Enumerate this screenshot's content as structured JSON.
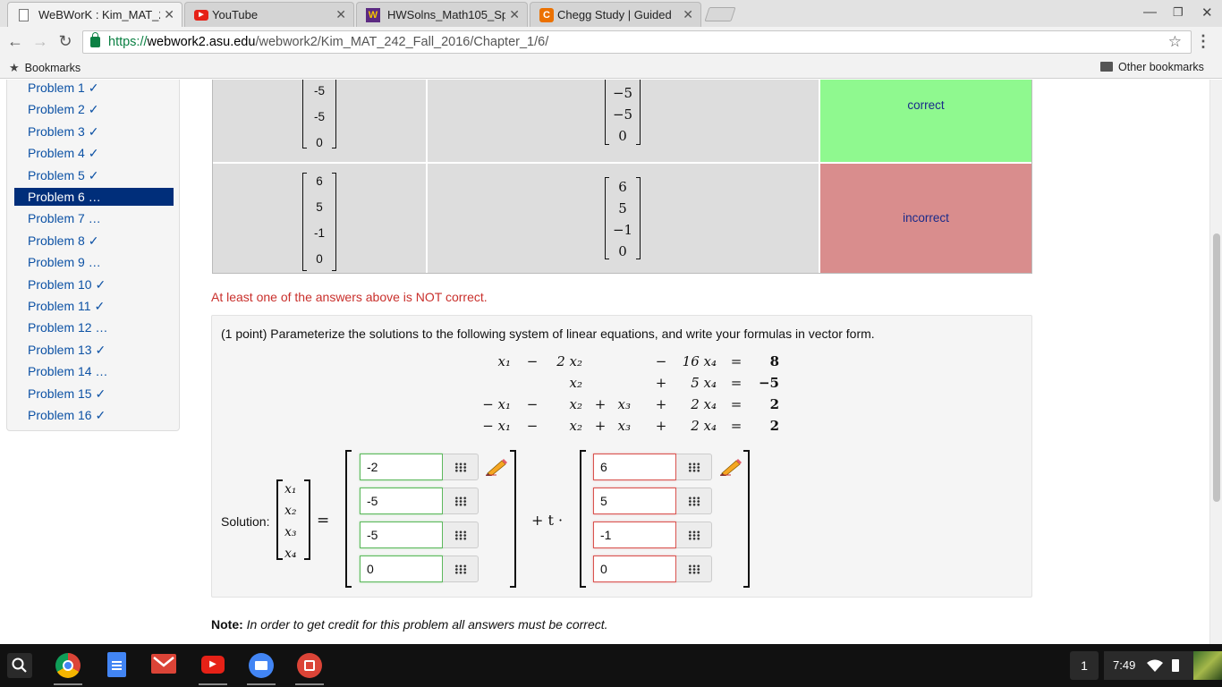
{
  "browser": {
    "tabs": [
      {
        "title": "WeBWorK : Kim_MAT_24",
        "icon": "page-icon",
        "active": true
      },
      {
        "title": "YouTube",
        "icon": "youtube-icon",
        "active": false
      },
      {
        "title": "HWSolns_Math105_Sp2",
        "icon": "hw-w-icon",
        "active": false
      },
      {
        "title": "Chegg Study | Guided So",
        "icon": "chegg-icon",
        "active": false
      }
    ],
    "url_scheme": "https://",
    "url_host": "webwork2.asu.edu",
    "url_path": "/webwork2/Kim_MAT_242_Fall_2016/Chapter_1/6/",
    "bookmarks_label": "Bookmarks",
    "other_bookmarks_label": "Other bookmarks"
  },
  "sidebar": {
    "problems": [
      {
        "label": "Problem 1 ✓"
      },
      {
        "label": "Problem 2 ✓"
      },
      {
        "label": "Problem 3 ✓"
      },
      {
        "label": "Problem 4 ✓"
      },
      {
        "label": "Problem 5 ✓"
      },
      {
        "label": "Problem 6 …",
        "current": true
      },
      {
        "label": "Problem 7 …"
      },
      {
        "label": "Problem 8 ✓"
      },
      {
        "label": "Problem 9 …"
      },
      {
        "label": "Problem 10 ✓"
      },
      {
        "label": "Problem 11 ✓"
      },
      {
        "label": "Problem 12 …"
      },
      {
        "label": "Problem 13 ✓"
      },
      {
        "label": "Problem 14 …"
      },
      {
        "label": "Problem 15 ✓"
      },
      {
        "label": "Problem 16 ✓"
      }
    ]
  },
  "results": {
    "row1": {
      "entered": [
        "-5",
        "-5",
        "0"
      ],
      "preview": [
        "−5",
        "−5",
        "0"
      ],
      "status": "correct"
    },
    "row2": {
      "entered": [
        "6",
        "5",
        "-1",
        "0"
      ],
      "preview": [
        "6",
        "5",
        "−1",
        "0"
      ],
      "status": "incorrect"
    },
    "warning": "At least one of the answers above is NOT correct."
  },
  "problem": {
    "text": "(1 point) Parameterize the solutions to the following system of linear equations, and write your formulas in vector form.",
    "equations": [
      {
        "c1": "x₁",
        "o2": "−",
        "c2": "2 x₂",
        "o3": "",
        "c3": "",
        "o4": "−",
        "c4": "16 x₄",
        "rhs": "8"
      },
      {
        "c1": "",
        "o2": "",
        "c2": "x₂",
        "o3": "",
        "c3": "",
        "o4": "+",
        "c4": "5 x₄",
        "rhs": "−5"
      },
      {
        "c1": "− x₁",
        "o2": "−",
        "c2": "x₂",
        "o3": "+",
        "c3": "x₃",
        "o4": "+",
        "c4": "2 x₄",
        "rhs": "2"
      },
      {
        "c1": "− x₁",
        "o2": "−",
        "c2": "x₂",
        "o3": "+",
        "c3": "x₃",
        "o4": "+",
        "c4": "2 x₄",
        "rhs": "2"
      }
    ],
    "solution_label": "Solution:",
    "vars": [
      "x₁",
      "x₂",
      "x₃",
      "x₄"
    ],
    "equals": "=",
    "plus_t": "+ t ·",
    "particular": [
      "-2",
      "-5",
      "-5",
      "0"
    ],
    "direction": [
      "6",
      "5",
      "-1",
      "0"
    ]
  },
  "note": {
    "bold": "Note:",
    "text": "In order to get credit for this problem all answers must be correct."
  },
  "shelf": {
    "apps": [
      "search-icon",
      "chrome-icon",
      "docs-icon",
      "gmail-icon",
      "youtube-icon",
      "files-icon",
      "photos-icon"
    ],
    "tray_number": "1",
    "clock": "7:49"
  }
}
